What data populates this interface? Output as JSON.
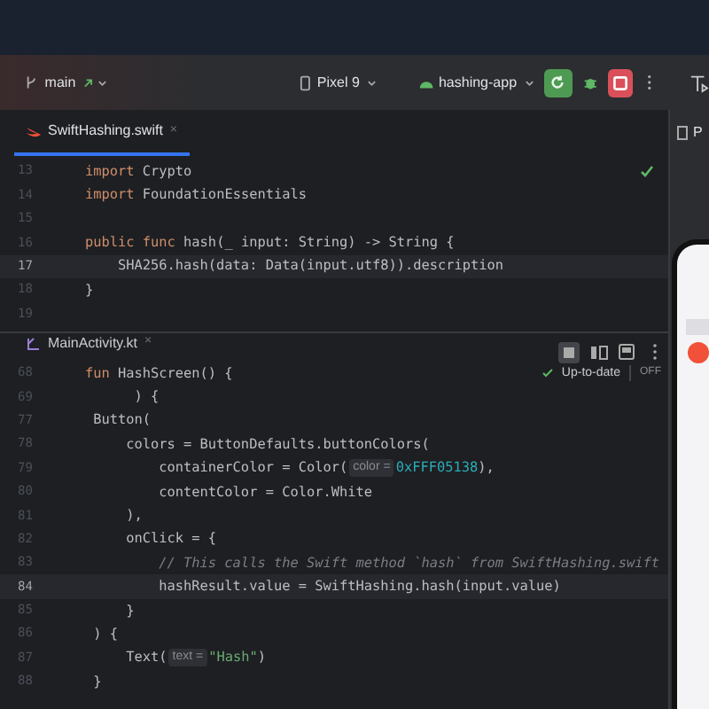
{
  "toolbar": {
    "branch": "main",
    "device": "Pixel 9",
    "run_config": "hashing-app"
  },
  "editors": [
    {
      "tab": {
        "label": "SwiftHashing.swift",
        "kind": "swift",
        "selected": true,
        "close": "×"
      },
      "lines": [
        {
          "number": "13",
          "current": false,
          "tokens": [
            {
              "kind": "keyword",
              "text": "import"
            },
            {
              "kind": "plain",
              "text": " Crypto"
            }
          ]
        },
        {
          "number": "14",
          "current": false,
          "tokens": [
            {
              "kind": "keyword",
              "text": "import"
            },
            {
              "kind": "plain",
              "text": " FoundationEssentials"
            }
          ]
        },
        {
          "number": "15",
          "current": false
        },
        {
          "number": "16",
          "current": false,
          "tokens": [
            {
              "kind": "keyword",
              "text": "public func"
            },
            {
              "kind": "plain",
              "text": " hash(_ input: String) -> String {"
            }
          ]
        },
        {
          "number": "17",
          "current": true,
          "tokens": [
            {
              "kind": "plain",
              "text": "    SHA256.hash(data: Data(input.utf8)).description"
            }
          ]
        },
        {
          "number": "18",
          "current": false,
          "tokens": [
            {
              "kind": "plain",
              "text": "}"
            }
          ]
        },
        {
          "number": "19",
          "current": false
        }
      ]
    },
    {
      "tab": {
        "label": "MainActivity.kt",
        "kind": "kotlin",
        "selected": false,
        "close": "×"
      },
      "status": {
        "label": "Up-to-date",
        "badge": "OFF"
      },
      "lines": [
        {
          "number": "68",
          "current": false,
          "tokens": [
            {
              "kind": "keyword",
              "text": "fun"
            },
            {
              "kind": "plain",
              "text": " HashScreen() {"
            }
          ]
        },
        {
          "number": "69",
          "current": false,
          "tokens": [
            {
              "kind": "plain",
              "text": "      ) {"
            }
          ]
        },
        {
          "number": "77",
          "current": false,
          "tokens": [
            {
              "kind": "plain",
              "text": " Button("
            }
          ]
        },
        {
          "number": "78",
          "current": false,
          "tokens": [
            {
              "kind": "plain",
              "text": "     colors = ButtonDefaults.buttonColors("
            }
          ]
        },
        {
          "number": "79",
          "current": false,
          "tokens": [
            {
              "kind": "plain",
              "text": "         containerColor = Color("
            },
            {
              "kind": "hint",
              "text": "color ="
            },
            {
              "kind": "number",
              "text": "0xFFF05138"
            },
            {
              "kind": "plain",
              "text": "),"
            }
          ]
        },
        {
          "number": "80",
          "current": false,
          "tokens": [
            {
              "kind": "plain",
              "text": "         contentColor = Color.White"
            }
          ]
        },
        {
          "number": "81",
          "current": false,
          "tokens": [
            {
              "kind": "plain",
              "text": "     ),"
            }
          ]
        },
        {
          "number": "82",
          "current": false,
          "tokens": [
            {
              "kind": "plain",
              "text": "     onClick = {"
            }
          ]
        },
        {
          "number": "83",
          "current": false,
          "tokens": [
            {
              "kind": "comment",
              "text": "         // This calls the Swift method `hash` from SwiftHashing.swift"
            }
          ]
        },
        {
          "number": "84",
          "current": true,
          "tokens": [
            {
              "kind": "plain",
              "text": "         hashResult.value = SwiftHashing.hash(input.value)"
            }
          ]
        },
        {
          "number": "85",
          "current": false,
          "tokens": [
            {
              "kind": "plain",
              "text": "     }"
            }
          ]
        },
        {
          "number": "86",
          "current": false,
          "tokens": [
            {
              "kind": "plain",
              "text": " ) {"
            }
          ]
        },
        {
          "number": "87",
          "current": false,
          "tokens": [
            {
              "kind": "plain",
              "text": "     Text("
            },
            {
              "kind": "hint",
              "text": "text ="
            },
            {
              "kind": "string",
              "text": "\"Hash\""
            },
            {
              "kind": "plain",
              "text": ")"
            }
          ]
        },
        {
          "number": "88",
          "current": false,
          "tokens": [
            {
              "kind": "plain",
              "text": " }"
            }
          ]
        }
      ]
    }
  ],
  "side_panel": {
    "tab": "P"
  }
}
